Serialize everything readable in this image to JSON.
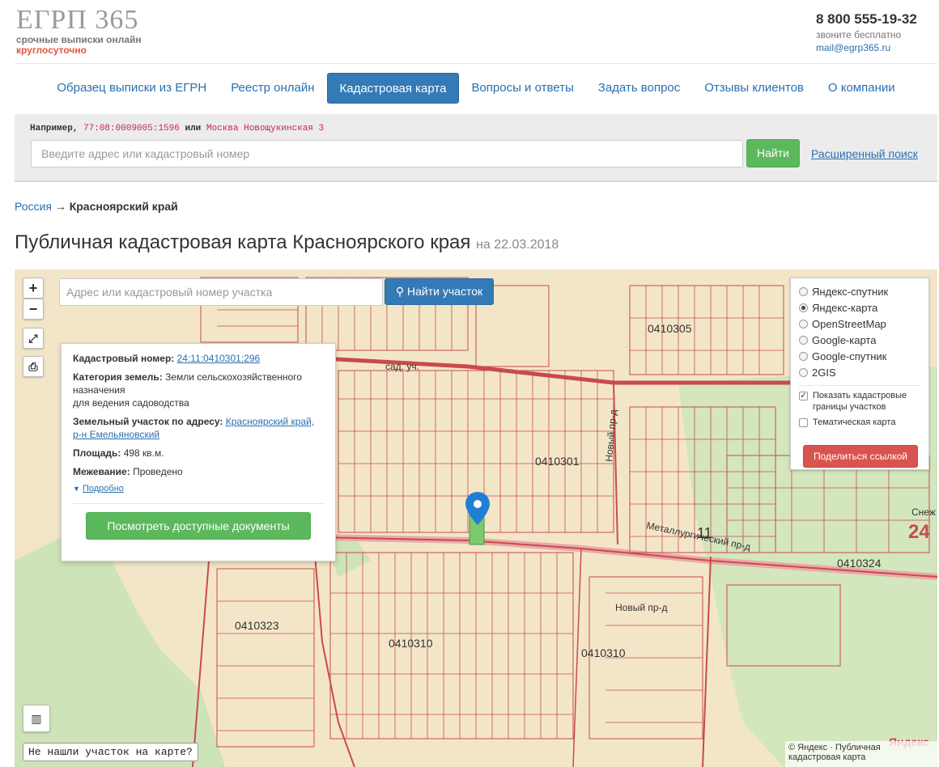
{
  "header": {
    "logo_title": "ЕГРП 365",
    "logo_sub": "срочные выписки онлайн",
    "logo_sub2": "круглосуточно",
    "phone": "8 800 555-19-32",
    "phone_note": "звоните бесплатно",
    "email": "mail@egrp365.ru"
  },
  "nav": {
    "items": [
      {
        "label": "Образец выписки из ЕГРН",
        "active": false
      },
      {
        "label": "Реестр онлайн",
        "active": false
      },
      {
        "label": "Кадастровая карта",
        "active": true
      },
      {
        "label": "Вопросы и ответы",
        "active": false
      },
      {
        "label": "Задать вопрос",
        "active": false
      },
      {
        "label": "Отзывы клиентов",
        "active": false
      },
      {
        "label": "О компании",
        "active": false
      }
    ]
  },
  "search": {
    "example_prefix": "Например,",
    "example_code": "77:08:0009005:1596",
    "example_or": "или",
    "example_address": "Москва Новощукинская 3",
    "placeholder": "Введите адрес или кадастровый номер",
    "button": "Найти",
    "advanced": "Расширенный поиск"
  },
  "breadcrumb": {
    "root": "Россия",
    "arrow": "→",
    "current": "Красноярский край"
  },
  "page": {
    "title": "Публичная кадастровая карта Красноярского края",
    "date": "на 22.03.2018"
  },
  "map": {
    "zoom_in": "+",
    "zoom_out": "−",
    "search_placeholder": "Адрес или кадастровый номер участка",
    "search_button": "Найти участок",
    "layers": [
      {
        "label": "Яндекс-спутник",
        "selected": false
      },
      {
        "label": "Яндекс-карта",
        "selected": true
      },
      {
        "label": "OpenStreetMap",
        "selected": false
      },
      {
        "label": "Google-карта",
        "selected": false
      },
      {
        "label": "Google-спутник",
        "selected": false
      },
      {
        "label": "2GIS",
        "selected": false
      }
    ],
    "show_borders_label": "Показать кадастровые границы участков",
    "show_borders_checked": true,
    "thematic_label": "Тематическая карта",
    "thematic_checked": false,
    "share_button": "Поделиться ссылкой",
    "not_found": "Не нашли участок на карте?",
    "copyright": "© Яндекс · Публичная кадастровая карта",
    "yandex_mark": "Яндекс",
    "labels": {
      "q1": "0410305",
      "q2": "0410301",
      "q3": "0410324",
      "q4": "0410323",
      "q5": "0410310",
      "q6": "0410310",
      "street1": "Металлургический пр-д",
      "street2": "Новый пр-д",
      "street3": "Новый пр-д",
      "street4": "сад. уч.",
      "big11": "11",
      "big24": "24",
      "snezh": "Снеж"
    }
  },
  "popup": {
    "cad_label": "Кадастровый номер:",
    "cad_value": "24:11:0410301:296",
    "cat_label": "Категория земель:",
    "cat_value": "Земли сельскохозяйственного назначения",
    "cat_value2": "для ведения садоводства",
    "addr_label": "Земельный участок по адресу:",
    "addr_value": "Красноярский край, р-н Емельяновский",
    "area_label": "Площадь:",
    "area_value": "498 кв.м.",
    "survey_label": "Межевание:",
    "survey_value": "Проведено",
    "more": "Подробно",
    "docs_button": "Посмотреть доступные документы"
  }
}
